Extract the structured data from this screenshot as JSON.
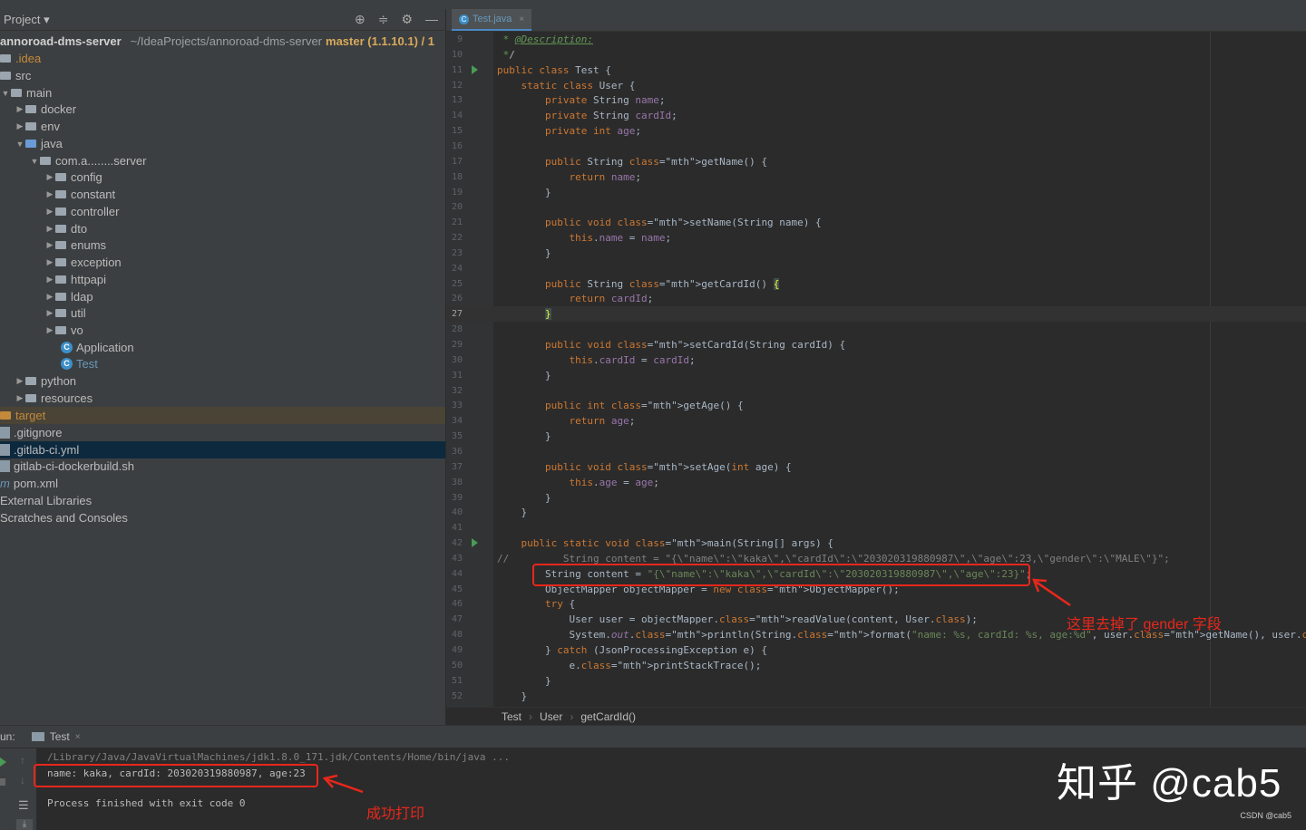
{
  "sidebar": {
    "project_label": "Project",
    "root": {
      "name": "annoroad-dms-server",
      "path": "~/IdeaProjects/annoroad-dms-server",
      "branch": "master (1.1.10.1) / 1"
    },
    "items": [
      {
        "label": ".idea",
        "type": "folder"
      },
      {
        "label": "src",
        "type": "folder"
      },
      {
        "label": "main",
        "type": "folder"
      },
      {
        "label": "docker",
        "type": "folder"
      },
      {
        "label": "env",
        "type": "folder"
      },
      {
        "label": "java",
        "type": "folder"
      },
      {
        "label": "com.a........server",
        "type": "package"
      },
      {
        "label": "config",
        "type": "package"
      },
      {
        "label": "constant",
        "type": "package"
      },
      {
        "label": "controller",
        "type": "package"
      },
      {
        "label": "dto",
        "type": "package"
      },
      {
        "label": "enums",
        "type": "package"
      },
      {
        "label": "exception",
        "type": "package"
      },
      {
        "label": "httpapi",
        "type": "package"
      },
      {
        "label": "ldap",
        "type": "package"
      },
      {
        "label": "util",
        "type": "package"
      },
      {
        "label": "vo",
        "type": "package"
      },
      {
        "label": "Application",
        "type": "class"
      },
      {
        "label": "Test",
        "type": "class"
      },
      {
        "label": "python",
        "type": "folder"
      },
      {
        "label": "resources",
        "type": "folder"
      },
      {
        "label": "target",
        "type": "folder"
      },
      {
        "label": ".gitignore",
        "type": "file"
      },
      {
        "label": ".gitlab-ci.yml",
        "type": "file"
      },
      {
        "label": "gitlab-ci-dockerbuild.sh",
        "type": "file"
      },
      {
        "label": "pom.xml",
        "type": "file"
      },
      {
        "label": "External Libraries",
        "type": "lib"
      },
      {
        "label": "Scratches and Consoles",
        "type": "lib"
      }
    ]
  },
  "editor": {
    "tab": "Test.java",
    "lines": [
      {
        "n": "9",
        "t": " * @Description:"
      },
      {
        "n": "10",
        "t": " */"
      },
      {
        "n": "11",
        "t": "public class Test {"
      },
      {
        "n": "12",
        "t": "    static class User {"
      },
      {
        "n": "13",
        "t": "        private String name;"
      },
      {
        "n": "14",
        "t": "        private String cardId;"
      },
      {
        "n": "15",
        "t": "        private int age;"
      },
      {
        "n": "16",
        "t": ""
      },
      {
        "n": "17",
        "t": "        public String getName() {"
      },
      {
        "n": "18",
        "t": "            return name;"
      },
      {
        "n": "19",
        "t": "        }"
      },
      {
        "n": "20",
        "t": ""
      },
      {
        "n": "21",
        "t": "        public void setName(String name) {"
      },
      {
        "n": "22",
        "t": "            this.name = name;"
      },
      {
        "n": "23",
        "t": "        }"
      },
      {
        "n": "24",
        "t": ""
      },
      {
        "n": "25",
        "t": "        public String getCardId() {"
      },
      {
        "n": "26",
        "t": "            return cardId;"
      },
      {
        "n": "27",
        "t": "        }"
      },
      {
        "n": "28",
        "t": ""
      },
      {
        "n": "29",
        "t": "        public void setCardId(String cardId) {"
      },
      {
        "n": "30",
        "t": "            this.cardId = cardId;"
      },
      {
        "n": "31",
        "t": "        }"
      },
      {
        "n": "32",
        "t": ""
      },
      {
        "n": "33",
        "t": "        public int getAge() {"
      },
      {
        "n": "34",
        "t": "            return age;"
      },
      {
        "n": "35",
        "t": "        }"
      },
      {
        "n": "36",
        "t": ""
      },
      {
        "n": "37",
        "t": "        public void setAge(int age) {"
      },
      {
        "n": "38",
        "t": "            this.age = age;"
      },
      {
        "n": "39",
        "t": "        }"
      },
      {
        "n": "40",
        "t": "    }"
      },
      {
        "n": "41",
        "t": ""
      },
      {
        "n": "42",
        "t": "    public static void main(String[] args) {"
      },
      {
        "n": "43",
        "t": "//         String content = \"{\\\"name\\\":\\\"kaka\\\",\\\"cardId\\\":\\\"203020319880987\\\",\\\"age\\\":23,\\\"gender\\\":\\\"MALE\\\"}\";"
      },
      {
        "n": "44",
        "t": "        String content = \"{\\\"name\\\":\\\"kaka\\\",\\\"cardId\\\":\\\"203020319880987\\\",\\\"age\\\":23}\";"
      },
      {
        "n": "45",
        "t": "        ObjectMapper objectMapper = new ObjectMapper();"
      },
      {
        "n": "46",
        "t": "        try {"
      },
      {
        "n": "47",
        "t": "            User user = objectMapper.readValue(content, User.class);"
      },
      {
        "n": "48",
        "t": "            System.out.println(String.format(\"name: %s, cardId: %s, age:%d\", user.getName(), user.getCardId(), user.getAge()));"
      },
      {
        "n": "49",
        "t": "        } catch (JsonProcessingException e) {"
      },
      {
        "n": "50",
        "t": "            e.printStackTrace();"
      },
      {
        "n": "51",
        "t": "        }"
      },
      {
        "n": "52",
        "t": "    }"
      }
    ],
    "breadcrumbs": [
      "Test",
      "User",
      "getCardId()"
    ],
    "annotation": "这里去掉了 gender 字段"
  },
  "run": {
    "label": "un:",
    "tab": "Test",
    "path": "/Library/Java/JavaVirtualMachines/jdk1.8.0_171.jdk/Contents/Home/bin/java ...",
    "output": "name: kaka, cardId: 203020319880987, age:23",
    "exit": "Process finished with exit code 0",
    "annotation": "成功打印"
  },
  "watermark": "知乎 @cab5",
  "csdn": "CSDN @cab5"
}
